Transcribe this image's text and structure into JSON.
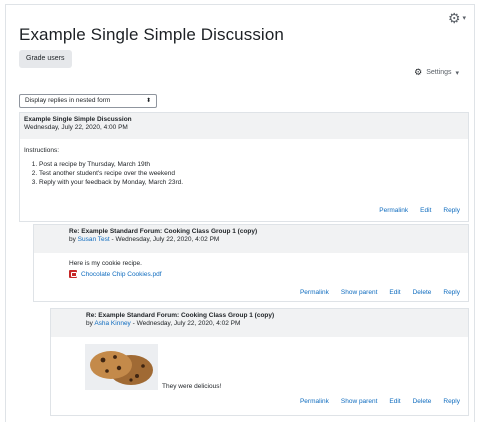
{
  "page": {
    "title": "Example Single Simple Discussion",
    "grade_button": "Grade users",
    "settings_label": "Settings",
    "display_mode": "Display replies in nested form"
  },
  "posts": [
    {
      "subject": "Example Single Simple Discussion",
      "date": "Wednesday, July 22, 2020, 4:00 PM",
      "instructions_label": "Instructions:",
      "items": [
        "Post a recipe by Thursday, March 19th",
        "Test another student's recipe over the weekend",
        "Reply with your feedback by Monday, March 23rd."
      ],
      "actions": [
        "Permalink",
        "Edit",
        "Reply"
      ]
    },
    {
      "subject": "Re: Example Standard Forum: Cooking Class Group 1 (copy)",
      "by_prefix": "by ",
      "author": "Susan Test",
      "date_suffix": " - Wednesday, July 22, 2020, 4:02 PM",
      "message": "Here is my cookie recipe.",
      "attachment": "Chocolate Chip Cookies.pdf",
      "actions": [
        "Permalink",
        "Show parent",
        "Edit",
        "Delete",
        "Reply"
      ]
    },
    {
      "subject": "Re: Example Standard Forum: Cooking Class Group 1 (copy)",
      "by_prefix": "by ",
      "author": "Asha Kinney",
      "date_suffix": " - Wednesday, July 22, 2020, 4:02 PM",
      "message": "They were delicious!",
      "actions": [
        "Permalink",
        "Show parent",
        "Edit",
        "Delete",
        "Reply"
      ]
    }
  ],
  "icons": {
    "gear": "gear-icon",
    "pdf": "pdf-file-icon"
  },
  "colors": {
    "link": "#0f6cbf",
    "header_bg": "#f1f2f3",
    "border": "#dfe3e7"
  }
}
